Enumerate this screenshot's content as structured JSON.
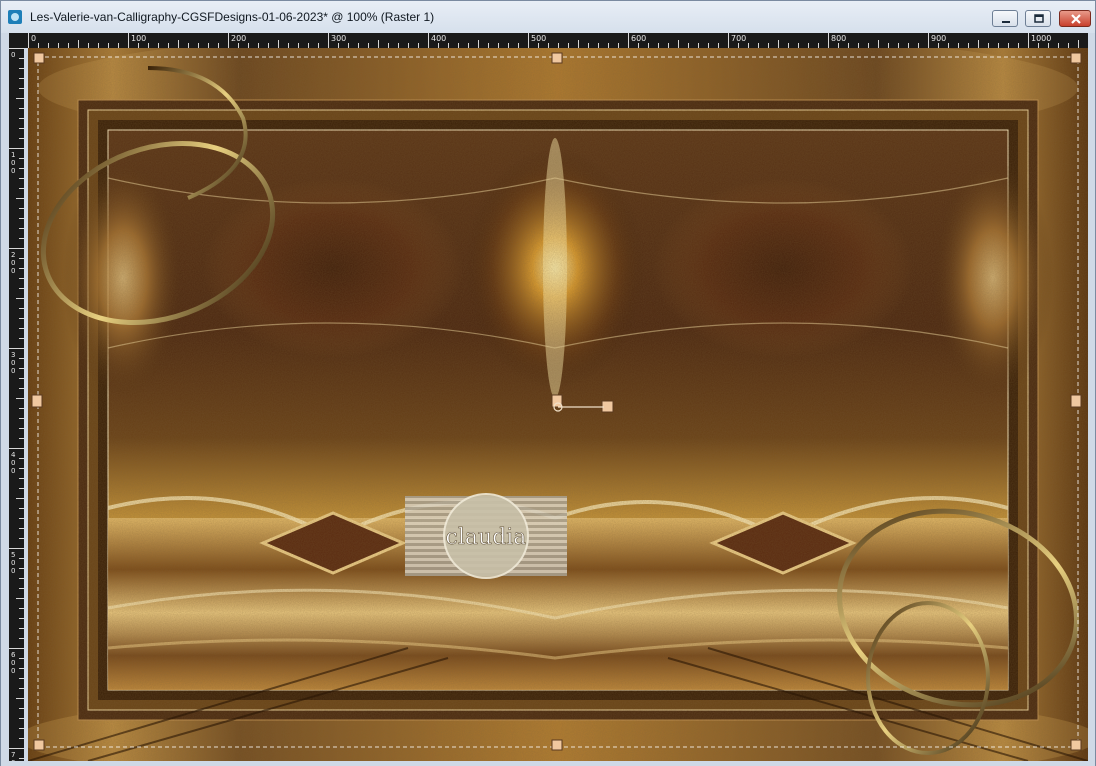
{
  "window": {
    "title": "Les-Valerie-van-Calligraphy-CGSFDesigns-01-06-2023* @ 100% (Raster 1)",
    "buttons": {
      "minimize": "minimize-icon",
      "maximize": "maximize-icon",
      "close": "close-icon"
    }
  },
  "ruler": {
    "horizontal_labels": [
      "0",
      "100",
      "200",
      "300",
      "400",
      "500",
      "600",
      "700",
      "800",
      "900",
      "1000"
    ],
    "vertical_labels": [
      "0",
      "100",
      "200",
      "300",
      "400",
      "500",
      "600",
      "700"
    ]
  },
  "canvas": {
    "watermark_text": "claudia",
    "colors": {
      "dark": "#3a1e08",
      "mid": "#8a5a1e",
      "gold": "#e8c070",
      "highlight": "#fff0c0",
      "selection": "#ffffff",
      "handle": "#f0c8a0"
    }
  }
}
